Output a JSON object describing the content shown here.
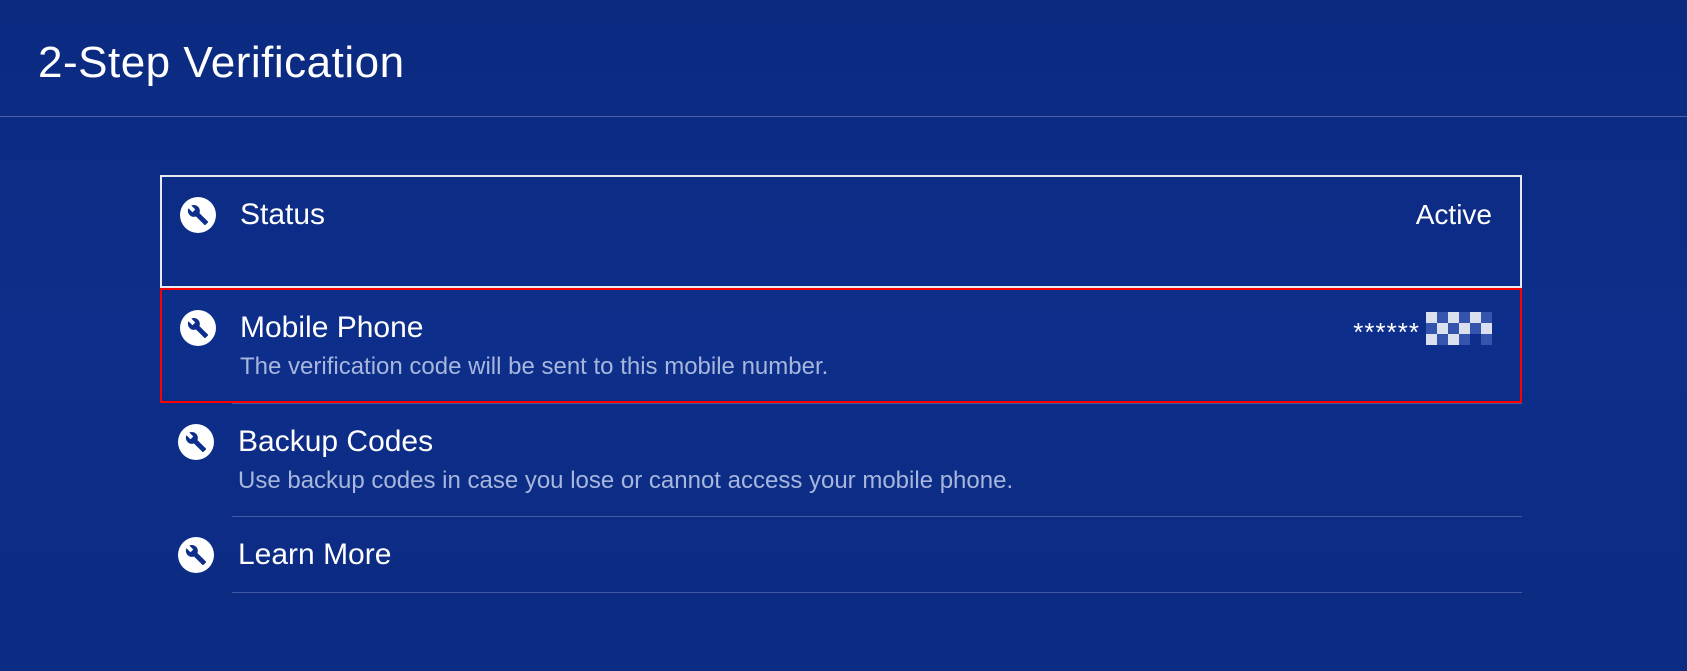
{
  "header": {
    "title": "2-Step Verification"
  },
  "items": [
    {
      "label": "Status",
      "description": "",
      "value": "Active"
    },
    {
      "label": "Mobile Phone",
      "description": "The verification code will be sent to this mobile number.",
      "value_prefix": "******"
    },
    {
      "label": "Backup Codes",
      "description": "Use backup codes in case you lose or cannot access your mobile phone.",
      "value": ""
    },
    {
      "label": "Learn More",
      "description": "",
      "value": ""
    }
  ]
}
